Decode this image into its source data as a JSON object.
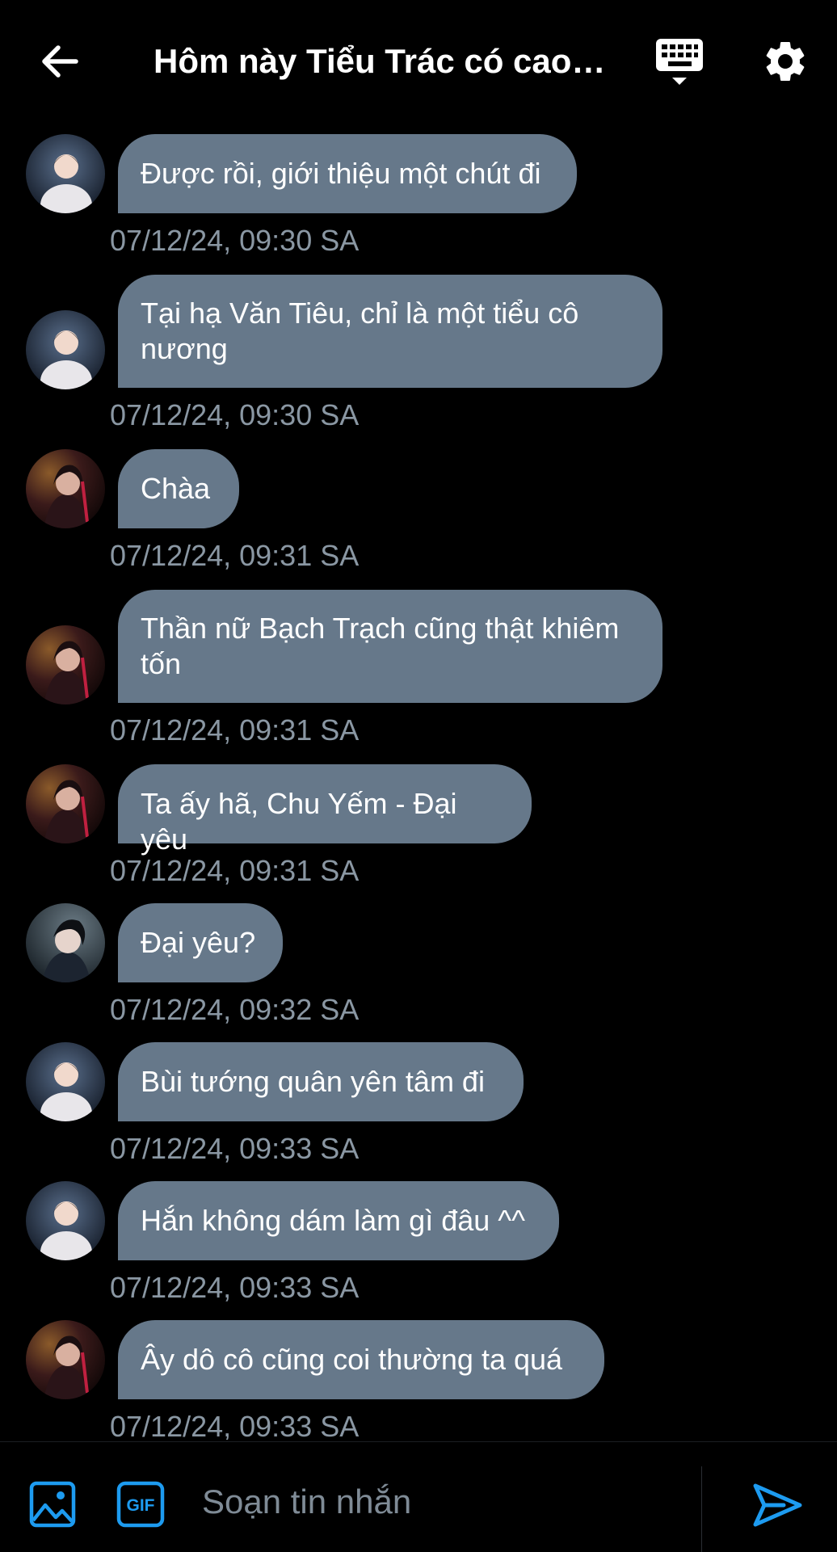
{
  "header": {
    "title": "Hôm này Tiểu Trác có cao…"
  },
  "messages": [
    {
      "avatar": "avatar-a",
      "text": "Được rồi, giới thiệu một chút đi",
      "time": "07/12/24, 09:30 SA"
    },
    {
      "avatar": "avatar-a",
      "text": "Tại hạ Văn Tiêu, chỉ là một tiểu cô nương",
      "time": "07/12/24, 09:30 SA"
    },
    {
      "avatar": "avatar-b",
      "text": "Chàa",
      "time": "07/12/24, 09:31 SA"
    },
    {
      "avatar": "avatar-b",
      "text": "Thần nữ Bạch Trạch cũng thật khiêm tốn",
      "time": "07/12/24, 09:31 SA"
    },
    {
      "avatar": "avatar-b",
      "text": "Ta ấy hã, Chu Yếm - Đại yêu",
      "time": "07/12/24, 09:31 SA"
    },
    {
      "avatar": "avatar-c",
      "text": "Đại yêu?",
      "time": "07/12/24, 09:32 SA"
    },
    {
      "avatar": "avatar-a",
      "text": "Bùi tướng quân yên tâm đi",
      "time": "07/12/24, 09:33 SA"
    },
    {
      "avatar": "avatar-a",
      "text": "Hắn không dám làm gì đâu ^^",
      "time": "07/12/24, 09:33 SA"
    },
    {
      "avatar": "avatar-b",
      "text": "Ây dô cô cũng coi thường ta quá",
      "time": "07/12/24, 09:33 SA"
    }
  ],
  "composer": {
    "placeholder": "Soạn tin nhắn",
    "gif_label": "GIF"
  },
  "icons": {
    "back": "arrow-left-icon",
    "keyboard": "keyboard-icon",
    "settings": "gear-icon",
    "image": "image-icon",
    "gif": "gif-icon",
    "send": "send-icon"
  },
  "colors": {
    "background": "#000000",
    "bubble": "#66788a",
    "timestamp": "#8a97a3",
    "accent": "#1d9bf0"
  }
}
